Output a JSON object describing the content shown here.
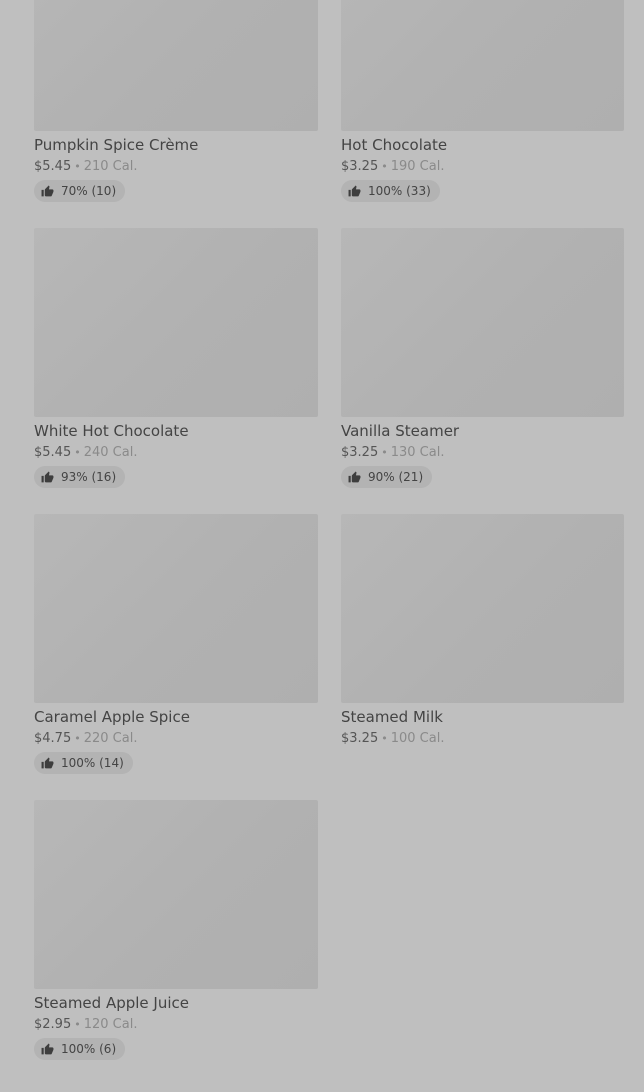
{
  "products": [
    {
      "name": "Pumpkin Spice Crème",
      "price": "$5.45",
      "separator": "•",
      "calories": "210 Cal.",
      "rating": "70% (10)",
      "rating_icon": "thumbs-up-icon"
    },
    {
      "name": "Hot Chocolate",
      "price": "$3.25",
      "separator": "•",
      "calories": "190 Cal.",
      "rating": "100% (33)",
      "rating_icon": "thumbs-up-icon"
    },
    {
      "name": "White Hot Chocolate",
      "price": "$5.45",
      "separator": "•",
      "calories": "240 Cal.",
      "rating": "93% (16)",
      "rating_icon": "thumbs-up-icon"
    },
    {
      "name": "Vanilla Steamer",
      "price": "$3.25",
      "separator": "•",
      "calories": "130 Cal.",
      "rating": "90% (21)",
      "rating_icon": "thumbs-up-icon"
    },
    {
      "name": "Caramel Apple Spice",
      "price": "$4.75",
      "separator": "•",
      "calories": "220 Cal.",
      "rating": "100% (14)",
      "rating_icon": "thumbs-up-icon"
    },
    {
      "name": "Steamed Milk",
      "price": "$3.25",
      "separator": "•",
      "calories": "100 Cal.",
      "rating": null
    },
    {
      "name": "Steamed Apple Juice",
      "price": "$2.95",
      "separator": "•",
      "calories": "120 Cal.",
      "rating": "100% (6)",
      "rating_icon": "thumbs-up-icon"
    }
  ]
}
